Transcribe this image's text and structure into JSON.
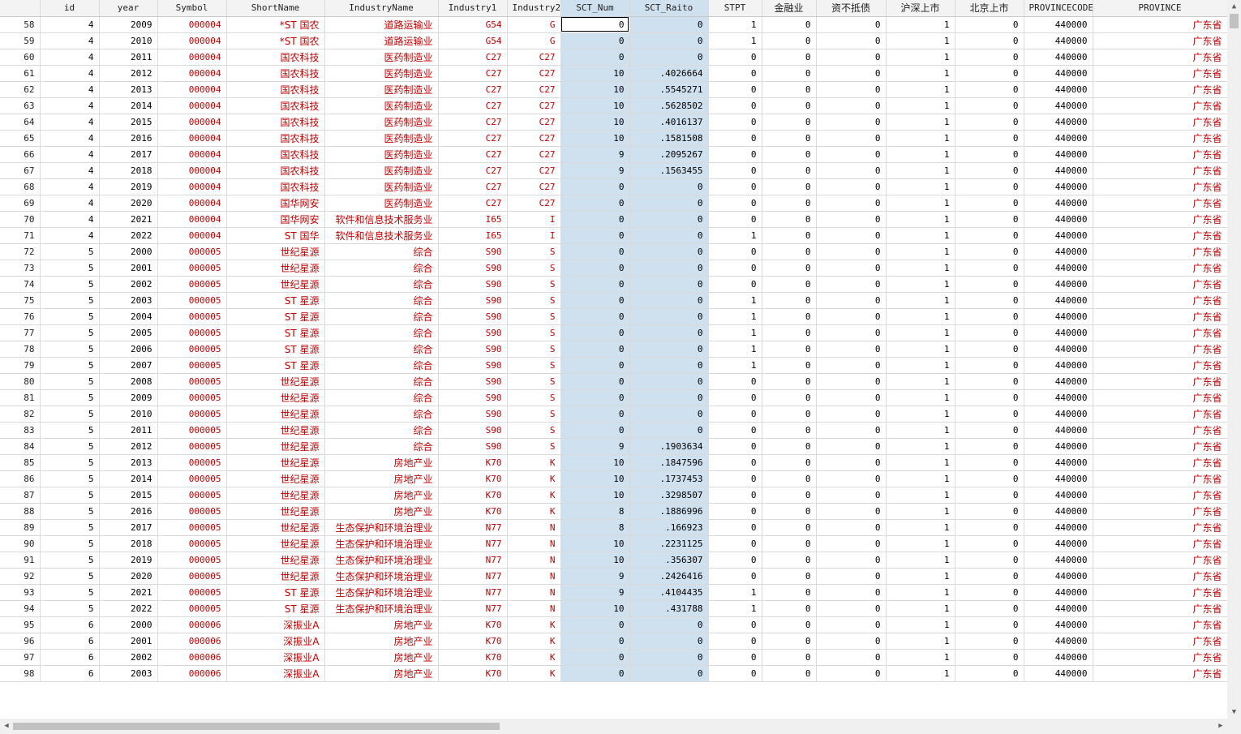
{
  "columns": [
    "",
    "id",
    "year",
    "Symbol",
    "ShortName",
    "IndustryName",
    "Industry1",
    "Industry2",
    "SCT_Num",
    "SCT_Raito",
    "STPT",
    "金融业",
    "资不抵债",
    "沪深上市",
    "北京上市",
    "PROVINCECODE",
    "PROVINCE"
  ],
  "rows": [
    [
      "58",
      "4",
      "2009",
      "000004",
      "*ST 国农",
      "道路运输业",
      "G54",
      "G",
      "0",
      "0",
      "1",
      "0",
      "0",
      "1",
      "0",
      "440000",
      "广东省"
    ],
    [
      "59",
      "4",
      "2010",
      "000004",
      "*ST 国农",
      "道路运输业",
      "G54",
      "G",
      "0",
      "0",
      "1",
      "0",
      "0",
      "1",
      "0",
      "440000",
      "广东省"
    ],
    [
      "60",
      "4",
      "2011",
      "000004",
      "国农科技",
      "医药制造业",
      "C27",
      "C27",
      "0",
      "0",
      "0",
      "0",
      "0",
      "1",
      "0",
      "440000",
      "广东省"
    ],
    [
      "61",
      "4",
      "2012",
      "000004",
      "国农科技",
      "医药制造业",
      "C27",
      "C27",
      "10",
      ".4026664",
      "0",
      "0",
      "0",
      "1",
      "0",
      "440000",
      "广东省"
    ],
    [
      "62",
      "4",
      "2013",
      "000004",
      "国农科技",
      "医药制造业",
      "C27",
      "C27",
      "10",
      ".5545271",
      "0",
      "0",
      "0",
      "1",
      "0",
      "440000",
      "广东省"
    ],
    [
      "63",
      "4",
      "2014",
      "000004",
      "国农科技",
      "医药制造业",
      "C27",
      "C27",
      "10",
      ".5628502",
      "0",
      "0",
      "0",
      "1",
      "0",
      "440000",
      "广东省"
    ],
    [
      "64",
      "4",
      "2015",
      "000004",
      "国农科技",
      "医药制造业",
      "C27",
      "C27",
      "10",
      ".4016137",
      "0",
      "0",
      "0",
      "1",
      "0",
      "440000",
      "广东省"
    ],
    [
      "65",
      "4",
      "2016",
      "000004",
      "国农科技",
      "医药制造业",
      "C27",
      "C27",
      "10",
      ".1581508",
      "0",
      "0",
      "0",
      "1",
      "0",
      "440000",
      "广东省"
    ],
    [
      "66",
      "4",
      "2017",
      "000004",
      "国农科技",
      "医药制造业",
      "C27",
      "C27",
      "9",
      ".2095267",
      "0",
      "0",
      "0",
      "1",
      "0",
      "440000",
      "广东省"
    ],
    [
      "67",
      "4",
      "2018",
      "000004",
      "国农科技",
      "医药制造业",
      "C27",
      "C27",
      "9",
      ".1563455",
      "0",
      "0",
      "0",
      "1",
      "0",
      "440000",
      "广东省"
    ],
    [
      "68",
      "4",
      "2019",
      "000004",
      "国农科技",
      "医药制造业",
      "C27",
      "C27",
      "0",
      "0",
      "0",
      "0",
      "0",
      "1",
      "0",
      "440000",
      "广东省"
    ],
    [
      "69",
      "4",
      "2020",
      "000004",
      "国华网安",
      "医药制造业",
      "C27",
      "C27",
      "0",
      "0",
      "0",
      "0",
      "0",
      "1",
      "0",
      "440000",
      "广东省"
    ],
    [
      "70",
      "4",
      "2021",
      "000004",
      "国华网安",
      "软件和信息技术服务业",
      "I65",
      "I",
      "0",
      "0",
      "0",
      "0",
      "0",
      "1",
      "0",
      "440000",
      "广东省"
    ],
    [
      "71",
      "4",
      "2022",
      "000004",
      "ST 国华",
      "软件和信息技术服务业",
      "I65",
      "I",
      "0",
      "0",
      "1",
      "0",
      "0",
      "1",
      "0",
      "440000",
      "广东省"
    ],
    [
      "72",
      "5",
      "2000",
      "000005",
      "世纪星源",
      "综合",
      "S90",
      "S",
      "0",
      "0",
      "0",
      "0",
      "0",
      "1",
      "0",
      "440000",
      "广东省"
    ],
    [
      "73",
      "5",
      "2001",
      "000005",
      "世纪星源",
      "综合",
      "S90",
      "S",
      "0",
      "0",
      "0",
      "0",
      "0",
      "1",
      "0",
      "440000",
      "广东省"
    ],
    [
      "74",
      "5",
      "2002",
      "000005",
      "世纪星源",
      "综合",
      "S90",
      "S",
      "0",
      "0",
      "0",
      "0",
      "0",
      "1",
      "0",
      "440000",
      "广东省"
    ],
    [
      "75",
      "5",
      "2003",
      "000005",
      "ST 星源",
      "综合",
      "S90",
      "S",
      "0",
      "0",
      "1",
      "0",
      "0",
      "1",
      "0",
      "440000",
      "广东省"
    ],
    [
      "76",
      "5",
      "2004",
      "000005",
      "ST 星源",
      "综合",
      "S90",
      "S",
      "0",
      "0",
      "1",
      "0",
      "0",
      "1",
      "0",
      "440000",
      "广东省"
    ],
    [
      "77",
      "5",
      "2005",
      "000005",
      "ST 星源",
      "综合",
      "S90",
      "S",
      "0",
      "0",
      "1",
      "0",
      "0",
      "1",
      "0",
      "440000",
      "广东省"
    ],
    [
      "78",
      "5",
      "2006",
      "000005",
      "ST 星源",
      "综合",
      "S90",
      "S",
      "0",
      "0",
      "1",
      "0",
      "0",
      "1",
      "0",
      "440000",
      "广东省"
    ],
    [
      "79",
      "5",
      "2007",
      "000005",
      "ST 星源",
      "综合",
      "S90",
      "S",
      "0",
      "0",
      "1",
      "0",
      "0",
      "1",
      "0",
      "440000",
      "广东省"
    ],
    [
      "80",
      "5",
      "2008",
      "000005",
      "世纪星源",
      "综合",
      "S90",
      "S",
      "0",
      "0",
      "0",
      "0",
      "0",
      "1",
      "0",
      "440000",
      "广东省"
    ],
    [
      "81",
      "5",
      "2009",
      "000005",
      "世纪星源",
      "综合",
      "S90",
      "S",
      "0",
      "0",
      "0",
      "0",
      "0",
      "1",
      "0",
      "440000",
      "广东省"
    ],
    [
      "82",
      "5",
      "2010",
      "000005",
      "世纪星源",
      "综合",
      "S90",
      "S",
      "0",
      "0",
      "0",
      "0",
      "0",
      "1",
      "0",
      "440000",
      "广东省"
    ],
    [
      "83",
      "5",
      "2011",
      "000005",
      "世纪星源",
      "综合",
      "S90",
      "S",
      "0",
      "0",
      "0",
      "0",
      "0",
      "1",
      "0",
      "440000",
      "广东省"
    ],
    [
      "84",
      "5",
      "2012",
      "000005",
      "世纪星源",
      "综合",
      "S90",
      "S",
      "9",
      ".1903634",
      "0",
      "0",
      "0",
      "1",
      "0",
      "440000",
      "广东省"
    ],
    [
      "85",
      "5",
      "2013",
      "000005",
      "世纪星源",
      "房地产业",
      "K70",
      "K",
      "10",
      ".1847596",
      "0",
      "0",
      "0",
      "1",
      "0",
      "440000",
      "广东省"
    ],
    [
      "86",
      "5",
      "2014",
      "000005",
      "世纪星源",
      "房地产业",
      "K70",
      "K",
      "10",
      ".1737453",
      "0",
      "0",
      "0",
      "1",
      "0",
      "440000",
      "广东省"
    ],
    [
      "87",
      "5",
      "2015",
      "000005",
      "世纪星源",
      "房地产业",
      "K70",
      "K",
      "10",
      ".3298507",
      "0",
      "0",
      "0",
      "1",
      "0",
      "440000",
      "广东省"
    ],
    [
      "88",
      "5",
      "2016",
      "000005",
      "世纪星源",
      "房地产业",
      "K70",
      "K",
      "8",
      ".1886996",
      "0",
      "0",
      "0",
      "1",
      "0",
      "440000",
      "广东省"
    ],
    [
      "89",
      "5",
      "2017",
      "000005",
      "世纪星源",
      "生态保护和环境治理业",
      "N77",
      "N",
      "8",
      ".166923",
      "0",
      "0",
      "0",
      "1",
      "0",
      "440000",
      "广东省"
    ],
    [
      "90",
      "5",
      "2018",
      "000005",
      "世纪星源",
      "生态保护和环境治理业",
      "N77",
      "N",
      "10",
      ".2231125",
      "0",
      "0",
      "0",
      "1",
      "0",
      "440000",
      "广东省"
    ],
    [
      "91",
      "5",
      "2019",
      "000005",
      "世纪星源",
      "生态保护和环境治理业",
      "N77",
      "N",
      "10",
      ".356307",
      "0",
      "0",
      "0",
      "1",
      "0",
      "440000",
      "广东省"
    ],
    [
      "92",
      "5",
      "2020",
      "000005",
      "世纪星源",
      "生态保护和环境治理业",
      "N77",
      "N",
      "9",
      ".2426416",
      "0",
      "0",
      "0",
      "1",
      "0",
      "440000",
      "广东省"
    ],
    [
      "93",
      "5",
      "2021",
      "000005",
      "ST 星源",
      "生态保护和环境治理业",
      "N77",
      "N",
      "9",
      ".4104435",
      "1",
      "0",
      "0",
      "1",
      "0",
      "440000",
      "广东省"
    ],
    [
      "94",
      "5",
      "2022",
      "000005",
      "ST 星源",
      "生态保护和环境治理业",
      "N77",
      "N",
      "10",
      ".431788",
      "1",
      "0",
      "0",
      "1",
      "0",
      "440000",
      "广东省"
    ],
    [
      "95",
      "6",
      "2000",
      "000006",
      "深振业A",
      "房地产业",
      "K70",
      "K",
      "0",
      "0",
      "0",
      "0",
      "0",
      "1",
      "0",
      "440000",
      "广东省"
    ],
    [
      "96",
      "6",
      "2001",
      "000006",
      "深振业A",
      "房地产业",
      "K70",
      "K",
      "0",
      "0",
      "0",
      "0",
      "0",
      "1",
      "0",
      "440000",
      "广东省"
    ],
    [
      "97",
      "6",
      "2002",
      "000006",
      "深振业A",
      "房地产业",
      "K70",
      "K",
      "0",
      "0",
      "0",
      "0",
      "0",
      "1",
      "0",
      "440000",
      "广东省"
    ],
    [
      "98",
      "6",
      "2003",
      "000006",
      "深振业A",
      "房地产业",
      "K70",
      "K",
      "0",
      "0",
      "0",
      "0",
      "0",
      "1",
      "0",
      "440000",
      "广东省"
    ]
  ],
  "scrollbars": {
    "up_icon": "▲",
    "down_icon": "▼",
    "left_icon": "◀",
    "right_icon": "▶"
  },
  "colors": {
    "text_string": "#c00000",
    "selection": "#cfe0ef"
  }
}
